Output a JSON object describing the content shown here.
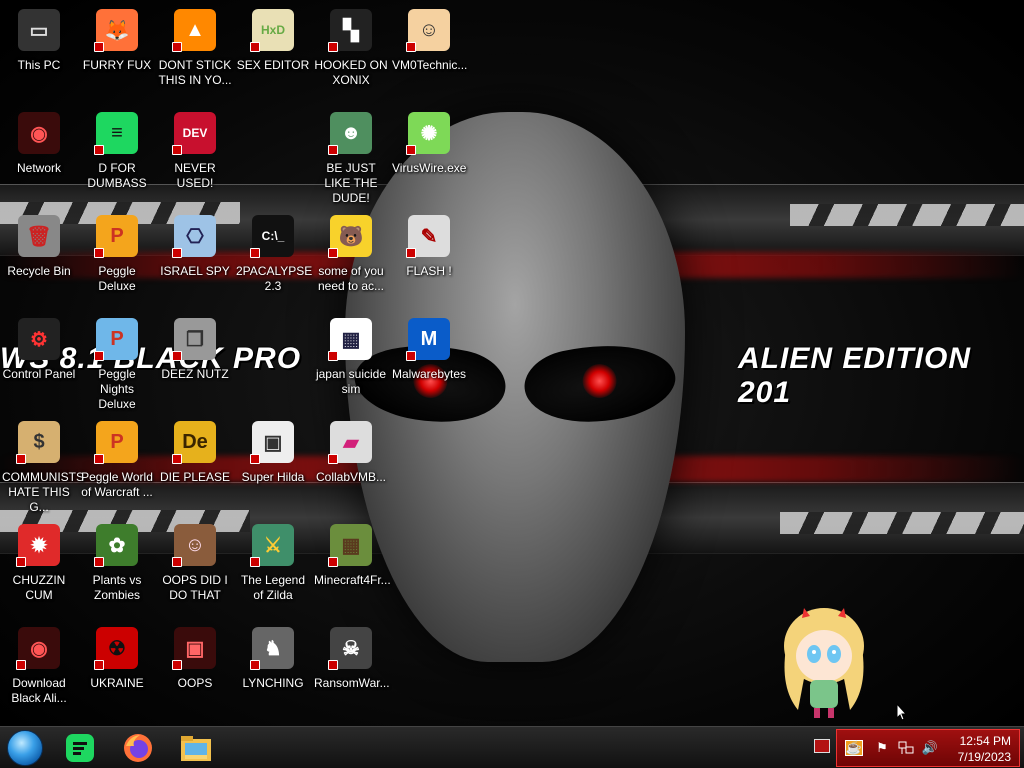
{
  "wallpaper": {
    "left_text": "WS 8.1 BLACK PRO",
    "right_text": "ALIEN EDITION 201"
  },
  "desktop": {
    "icons": [
      {
        "label": "This PC",
        "icon": "computer-icon"
      },
      {
        "label": "FURRY FUX",
        "icon": "firefox-icon"
      },
      {
        "label": "DONT STICK THIS IN YO...",
        "icon": "vlc-cone-icon"
      },
      {
        "label": "SEX EDITOR",
        "icon": "hxd-icon"
      },
      {
        "label": "HOOKED ON XONIX",
        "icon": "xonix-icon"
      },
      {
        "label": "VM0Technic...",
        "icon": "doctor-icon"
      },
      {
        "label": "Network",
        "icon": "network-icon"
      },
      {
        "label": "D FOR DUMBASS",
        "icon": "d-app-icon"
      },
      {
        "label": "NEVER USED!",
        "icon": "devcpp-icon"
      },
      {
        "label": "BE JUST LIKE THE DUDE!",
        "icon": "elf-icon"
      },
      {
        "label": "VirusWire.exe",
        "icon": "lime-icon"
      },
      {
        "label": "Recycle Bin",
        "icon": "recycle-bin-icon"
      },
      {
        "label": "Peggle Deluxe",
        "icon": "peggle-icon"
      },
      {
        "label": "ISRAEL SPY",
        "icon": "spy-icon"
      },
      {
        "label": "2PACALYPSE 2.3",
        "icon": "terminal-icon"
      },
      {
        "label": "some of you need to ac...",
        "icon": "beaver-icon"
      },
      {
        "label": "FLASH !",
        "icon": "flash-icon"
      },
      {
        "label": "Control Panel",
        "icon": "control-panel-icon"
      },
      {
        "label": "Peggle Nights Deluxe",
        "icon": "peggle-nights-icon"
      },
      {
        "label": "DEEZ NUTZ",
        "icon": "stack-icon"
      },
      {
        "label": "japan suicide sim",
        "icon": "document-icon"
      },
      {
        "label": "Malwarebytes",
        "icon": "malwarebytes-icon"
      },
      {
        "label": "COMMUNISTS HATE THIS G...",
        "icon": "money-bag-icon"
      },
      {
        "label": "Peggle World of Warcraft ...",
        "icon": "peggle-wow-icon"
      },
      {
        "label": "DIE PLEASE",
        "icon": "de-icon"
      },
      {
        "label": "Super Hilda",
        "icon": "hilda-icon"
      },
      {
        "label": "CollabVMB...",
        "icon": "collabvm-icon"
      },
      {
        "label": "CHUZZIN CUM",
        "icon": "chuzzle-icon"
      },
      {
        "label": "Plants vs Zombies",
        "icon": "pvz-icon"
      },
      {
        "label": "OOPS DID I DO THAT",
        "icon": "portrait-icon"
      },
      {
        "label": "The Legend of Zilda",
        "icon": "zelda-icon"
      },
      {
        "label": "Minecraft4Fr...",
        "icon": "minecraft-icon"
      },
      {
        "label": "Download Black Ali...",
        "icon": "alien-network-icon"
      },
      {
        "label": "UKRAINE",
        "icon": "radiation-icon"
      },
      {
        "label": "OOPS",
        "icon": "oops-icon"
      },
      {
        "label": "LYNCHING",
        "icon": "bell-icon"
      },
      {
        "label": "RansomWar...",
        "icon": "skull-icon"
      }
    ]
  },
  "taskbar": {
    "apps": [
      {
        "name": "green-app-icon"
      },
      {
        "name": "firefox-icon"
      },
      {
        "name": "file-explorer-icon"
      }
    ],
    "clock": {
      "time": "12:54 PM",
      "date": "7/19/2023"
    }
  }
}
